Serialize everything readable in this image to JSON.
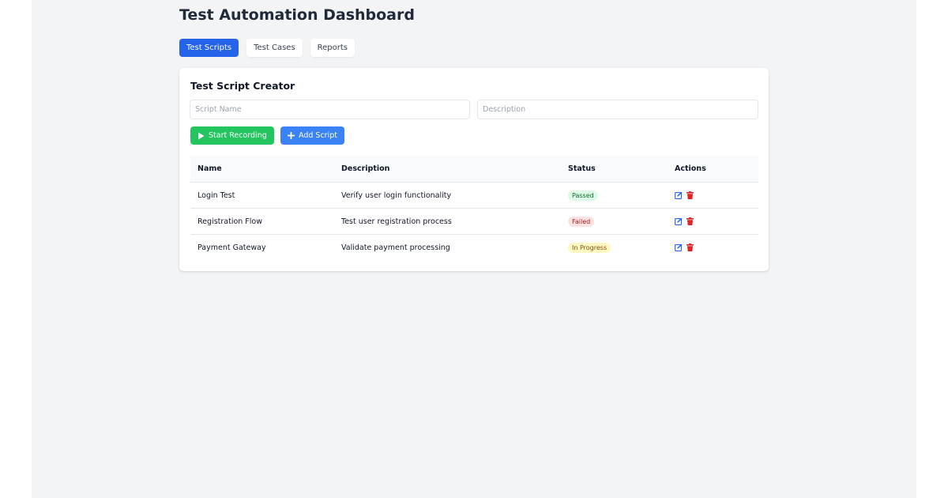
{
  "app": {
    "title": "Test Automation Dashboard"
  },
  "tabs": [
    {
      "label": "Test Scripts",
      "active": true
    },
    {
      "label": "Test Cases",
      "active": false
    },
    {
      "label": "Reports",
      "active": false
    }
  ],
  "creator": {
    "title": "Test Script Creator",
    "script_name": {
      "value": "",
      "placeholder": "Script Name"
    },
    "description": {
      "value": "",
      "placeholder": "Description"
    },
    "record_button": {
      "label": "Start Recording",
      "icon": "play-icon",
      "color": "#22c55e"
    },
    "add_button": {
      "label": "Add Script",
      "icon": "plus-icon",
      "color": "#3b82f6"
    }
  },
  "table": {
    "headers": [
      "Name",
      "Description",
      "Status",
      "Actions"
    ],
    "rows": [
      {
        "name": "Login Test",
        "description": "Verify user login functionality",
        "status": "Passed",
        "status_kind": "passed"
      },
      {
        "name": "Registration Flow",
        "description": "Test user registration process",
        "status": "Failed",
        "status_kind": "failed"
      },
      {
        "name": "Payment Gateway",
        "description": "Validate payment processing",
        "status": "In Progress",
        "status_kind": "progress"
      }
    ],
    "action_icons": [
      "edit-icon",
      "trash-icon"
    ]
  },
  "colors": {
    "accent": "#2563eb",
    "success": "#22c55e",
    "primary_button": "#3b82f6",
    "danger": "#dc2626"
  }
}
